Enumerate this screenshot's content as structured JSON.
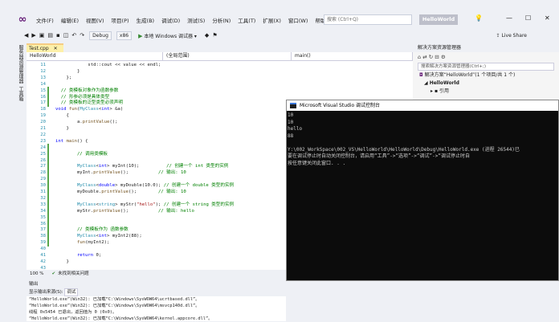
{
  "menubar": {
    "logo": "VS",
    "items": [
      "文件(F)",
      "编辑(E)",
      "视图(V)",
      "项目(P)",
      "生成(B)",
      "调试(D)",
      "测试(S)",
      "分析(N)",
      "工具(T)",
      "扩展(X)",
      "窗口(W)",
      "帮助(H)"
    ],
    "search_placeholder": "搜索 (Ctrl+Q)",
    "app_title": "HelloWorld",
    "min": "—",
    "max": "☐",
    "close": "✕"
  },
  "toolbar": {
    "config": "Debug",
    "platform": "x86",
    "run_label": "本地 Windows 调试器",
    "liveshare": "Live Share"
  },
  "left_strip": {
    "tab1": "服务器资源管理器",
    "tab2": "工具箱"
  },
  "editor": {
    "tab_label": "Test.cpp",
    "tab_close": "✕",
    "nav_project": "HelloWorld",
    "nav_scope": "(全局范围)",
    "nav_member": "main()",
    "status_zoom": "100 %",
    "status_issues": "未找到相关问题"
  },
  "code_lines": [
    {
      "n": "11",
      "tokens": [
        [
          "nm",
          "            std::cout << value << endl;"
        ]
      ]
    },
    {
      "n": "12",
      "tokens": [
        [
          "nm",
          "        }"
        ]
      ]
    },
    {
      "n": "13",
      "tokens": [
        [
          "nm",
          "    };"
        ]
      ]
    },
    {
      "n": "14",
      "tokens": [
        [
          "nm",
          ""
        ]
      ]
    },
    {
      "n": "15",
      "tokens": [
        [
          "cm",
          "  // 类模板对象作为函数参数"
        ]
      ]
    },
    {
      "n": "16",
      "tokens": [
        [
          "cm",
          "  // 形参必须是具体类型"
        ]
      ]
    },
    {
      "n": "17",
      "tokens": [
        [
          "cm",
          "  // 类模板的泛型类型必须声明"
        ]
      ]
    },
    {
      "n": "18",
      "tokens": [
        [
          "kw",
          "void "
        ],
        [
          "fn",
          "fun"
        ],
        [
          "nm",
          "("
        ],
        [
          "ty",
          "MyClass"
        ],
        [
          "nm",
          "<"
        ],
        [
          "kw",
          "int"
        ],
        [
          "nm",
          "> &a)"
        ]
      ]
    },
    {
      "n": "19",
      "tokens": [
        [
          "nm",
          "    {"
        ]
      ]
    },
    {
      "n": "20",
      "tokens": [
        [
          "nm",
          "        a."
        ],
        [
          "fn",
          "printValue"
        ],
        [
          "nm",
          "();"
        ]
      ]
    },
    {
      "n": "21",
      "tokens": [
        [
          "nm",
          "    }"
        ]
      ]
    },
    {
      "n": "22",
      "tokens": [
        [
          "nm",
          ""
        ]
      ]
    },
    {
      "n": "23",
      "tokens": [
        [
          "kw",
          "int "
        ],
        [
          "fn",
          "main"
        ],
        [
          "nm",
          "() {"
        ]
      ]
    },
    {
      "n": "24",
      "tokens": [
        [
          "nm",
          ""
        ]
      ]
    },
    {
      "n": "25",
      "tokens": [
        [
          "cm",
          "        // 调用类模板"
        ]
      ]
    },
    {
      "n": "26",
      "tokens": [
        [
          "nm",
          ""
        ]
      ]
    },
    {
      "n": "27",
      "tokens": [
        [
          "ty",
          "        MyClass"
        ],
        [
          "nm",
          "<"
        ],
        [
          "kw",
          "int"
        ],
        [
          "nm",
          "> myInt(10);          "
        ],
        [
          "cm",
          "// 创建一个 int 类型的实例"
        ]
      ]
    },
    {
      "n": "28",
      "tokens": [
        [
          "nm",
          "        myInt."
        ],
        [
          "fn",
          "printValue"
        ],
        [
          "nm",
          "();           "
        ],
        [
          "cm",
          "// 输出: 10"
        ]
      ]
    },
    {
      "n": "29",
      "tokens": [
        [
          "nm",
          ""
        ]
      ]
    },
    {
      "n": "30",
      "tokens": [
        [
          "ty",
          "        MyClass"
        ],
        [
          "nm",
          "<"
        ],
        [
          "kw",
          "double"
        ],
        [
          "nm",
          "> myDouble(10.0); "
        ],
        [
          "cm",
          "// 创建一个 double 类型的实例"
        ]
      ]
    },
    {
      "n": "31",
      "tokens": [
        [
          "nm",
          "        myDouble."
        ],
        [
          "fn",
          "printValue"
        ],
        [
          "nm",
          "();        "
        ],
        [
          "cm",
          "// 输出: 10"
        ]
      ]
    },
    {
      "n": "32",
      "tokens": [
        [
          "nm",
          ""
        ]
      ]
    },
    {
      "n": "33",
      "tokens": [
        [
          "ty",
          "        MyClass"
        ],
        [
          "nm",
          "<"
        ],
        [
          "ty",
          "string"
        ],
        [
          "nm",
          "> myStr("
        ],
        [
          "st",
          "\"hello\""
        ],
        [
          "nm",
          "); "
        ],
        [
          "cm",
          "// 创建一个 string 类型的实例"
        ]
      ]
    },
    {
      "n": "34",
      "tokens": [
        [
          "nm",
          "        myStr."
        ],
        [
          "fn",
          "printValue"
        ],
        [
          "nm",
          "();           "
        ],
        [
          "cm",
          "// 输出: hello"
        ]
      ]
    },
    {
      "n": "35",
      "tokens": [
        [
          "nm",
          ""
        ]
      ]
    },
    {
      "n": "36",
      "tokens": [
        [
          "nm",
          ""
        ]
      ]
    },
    {
      "n": "37",
      "tokens": [
        [
          "cm",
          "        // 类模板作为 函数参数"
        ]
      ]
    },
    {
      "n": "38",
      "tokens": [
        [
          "ty",
          "        MyClass"
        ],
        [
          "nm",
          "<"
        ],
        [
          "kw",
          "int"
        ],
        [
          "nm",
          "> myInt2(88);"
        ]
      ]
    },
    {
      "n": "39",
      "tokens": [
        [
          "nm",
          "        "
        ],
        [
          "fn",
          "fun"
        ],
        [
          "nm",
          "(myInt2);"
        ]
      ]
    },
    {
      "n": "40",
      "tokens": [
        [
          "nm",
          ""
        ]
      ]
    },
    {
      "n": "41",
      "tokens": [
        [
          "kw",
          "        return "
        ],
        [
          "nm",
          "0;"
        ]
      ]
    },
    {
      "n": "42",
      "tokens": [
        [
          "nm",
          "    }"
        ]
      ]
    },
    {
      "n": "43",
      "tokens": [
        [
          "nm",
          ""
        ]
      ]
    }
  ],
  "console": {
    "title": "Microsoft Visual Studio 调试控制台",
    "lines": [
      "10",
      "10",
      "hello",
      "88",
      "",
      "Y:\\002_WorkSpace\\002_VS\\HelloWorld\\HelloWorld\\Debug\\HelloWorld.exe (进程 26544)已",
      "要在调试停止时自动关闭控制台，请启用“工具”->“选项”->“调试”->“调试停止时自",
      "按任意键关闭此窗口. . ."
    ]
  },
  "solution": {
    "title": "解决方案资源管理器",
    "search_placeholder": "搜索解决方案资源管理器(Ctrl+;)",
    "items": [
      "解决方案“HelloWorld”(1 个项目/共 1 个)",
      "HelloWorld",
      "引用"
    ]
  },
  "output": {
    "title": "输出",
    "source_label": "显示输出来源(S):",
    "source_value": "调试",
    "lines": [
      "“HelloWorld.exe”(Win32): 已加载“C:\\Windows\\SysWOW64\\ucrtbased.dll”。",
      "“HelloWorld.exe”(Win32): 已加载“C:\\Windows\\SysWOW64\\msvcp140d.dll”。",
      "线程 0x5454 已退出，返回值为 0 (0x0)。",
      "“HelloWorld.exe”(Win32): 已加载“C:\\Windows\\SysWOW64\\kernel.appcore.dll”。"
    ]
  }
}
